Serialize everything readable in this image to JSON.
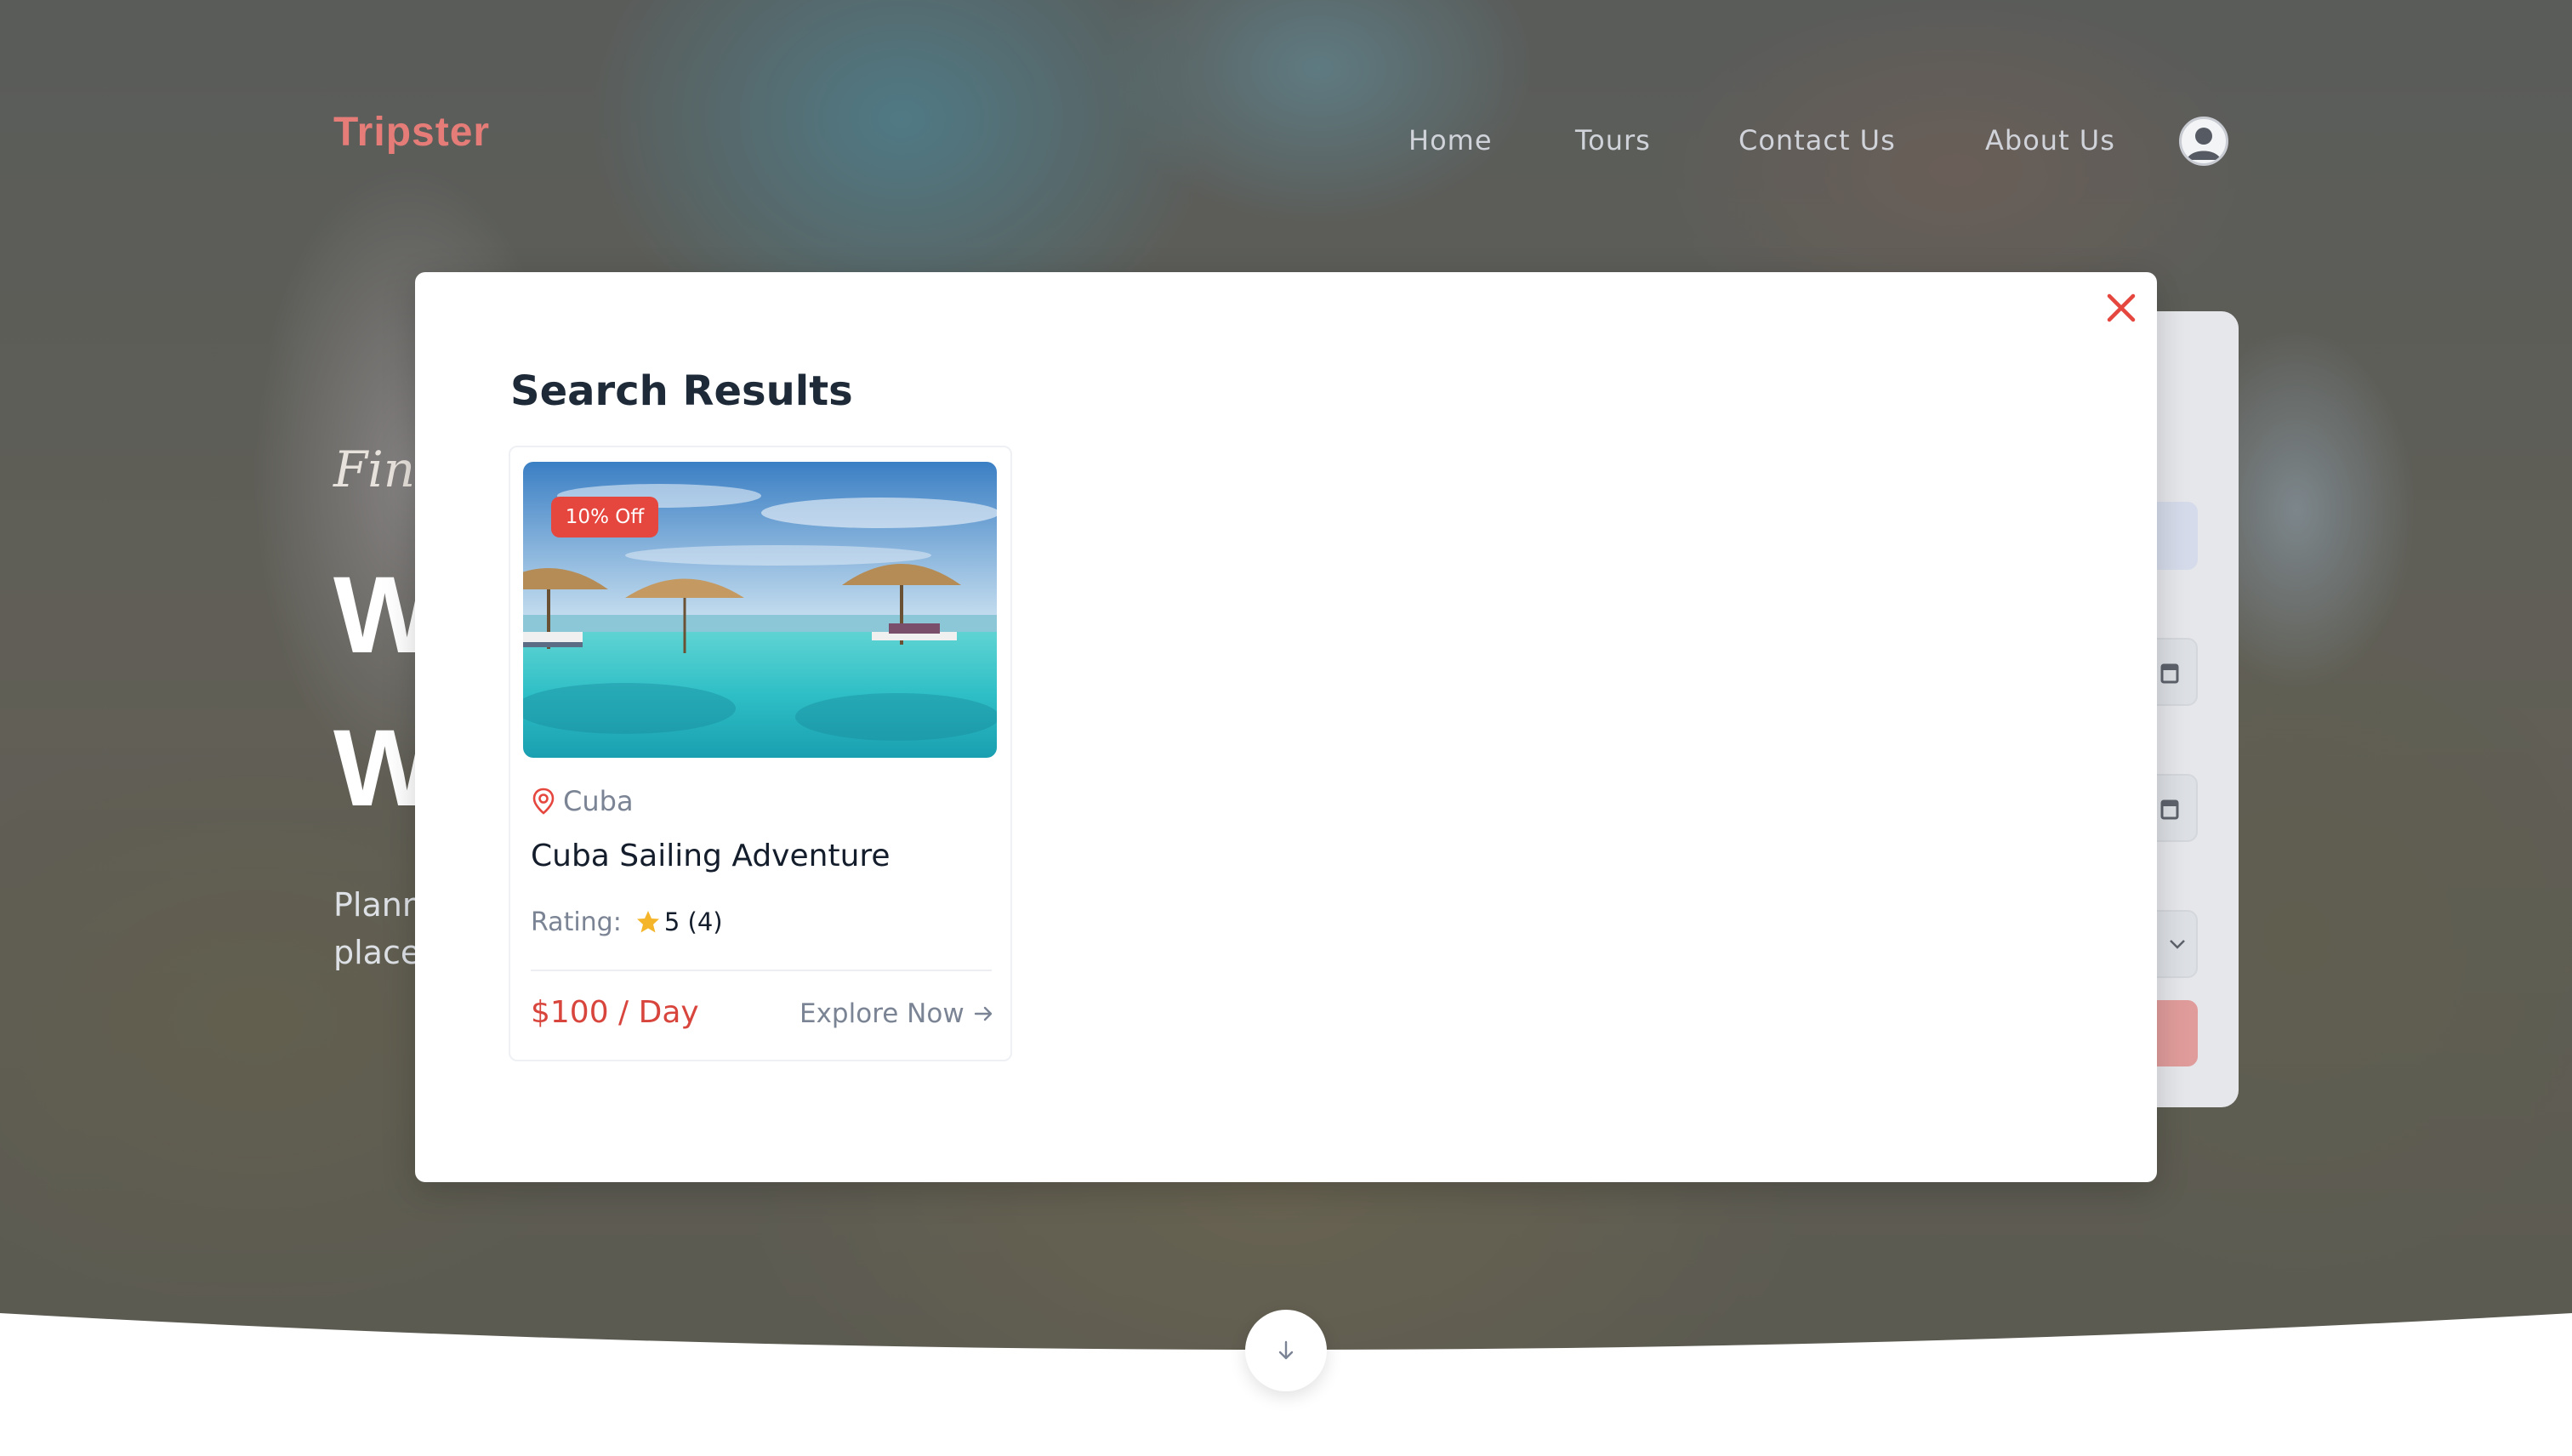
{
  "brand": {
    "logo": "Tripster",
    "accent_color": "#e57c78"
  },
  "nav": {
    "items": [
      {
        "label": "Home"
      },
      {
        "label": "Tours"
      },
      {
        "label": "Contact Us"
      },
      {
        "label": "About Us"
      }
    ],
    "profile_icon": "user-circle-icon"
  },
  "hero": {
    "tagline_partial": "Find",
    "headline_line1_partial": "W",
    "headline_line2_partial": "W",
    "description_line1_partial": "Plann",
    "description_line2_partial": "place"
  },
  "modal": {
    "title": "Search Results",
    "close_icon": "close-icon",
    "close_color": "#e5473f",
    "results": [
      {
        "discount": "10% Off",
        "location": "Cuba",
        "title": "Cuba Sailing Adventure",
        "rating_label": "Rating:",
        "rating_value": "5 (4)",
        "price": "$100 / Day",
        "cta": "Explore Now",
        "image": "infinity pool with beach umbrellas and loungers by the sea"
      }
    ]
  },
  "scroll_icon": "arrow-down-icon"
}
